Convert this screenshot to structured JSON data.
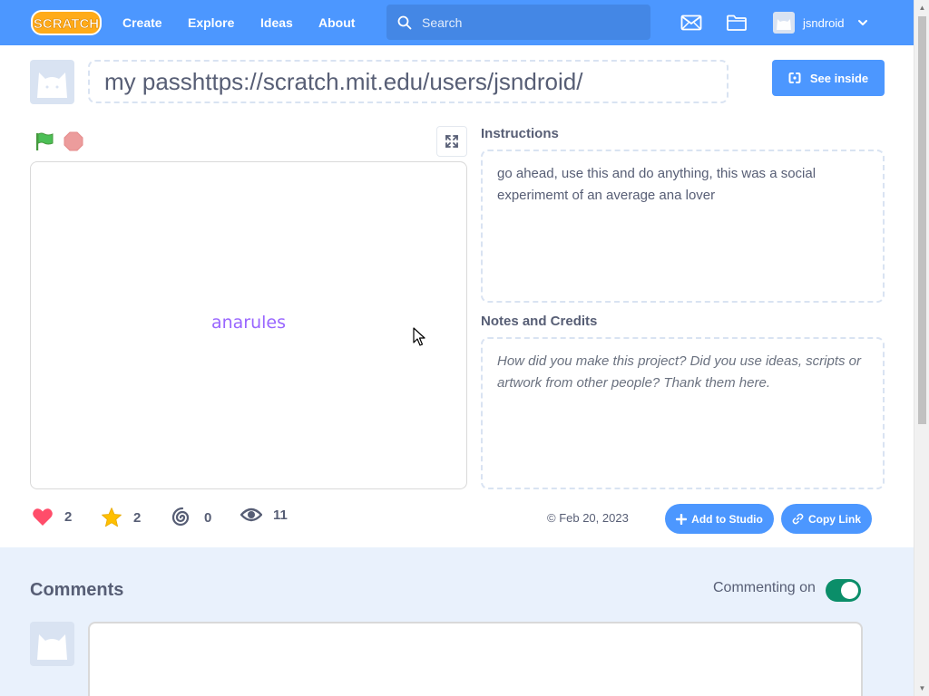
{
  "nav": {
    "logo_text": "SCRATCH",
    "links": [
      "Create",
      "Explore",
      "Ideas",
      "About"
    ],
    "search_placeholder": "Search",
    "username": "jsndroid"
  },
  "project": {
    "title": "my passhttps://scratch.mit.edu/users/jsndroid/",
    "see_inside_label": "See inside",
    "stage_text": "anarules"
  },
  "instructions": {
    "label": "Instructions",
    "text": "go ahead, use this and do anything, this was a social experimemt of an average ana lover"
  },
  "notes": {
    "label": "Notes and Credits",
    "placeholder": "How did you make this project? Did you use ideas, scripts or artwork from other people? Thank them here."
  },
  "stats": {
    "loves": "2",
    "favorites": "2",
    "remixes": "0",
    "views": "11"
  },
  "share_date": "© Feb 20, 2023",
  "actions": {
    "add_to_studio": "Add to Studio",
    "copy_link": "Copy Link"
  },
  "comments": {
    "title": "Comments",
    "commenting_label": "Commenting on",
    "commenting_on": true
  },
  "colors": {
    "brand": "#4c97ff",
    "text": "#575e75",
    "stage_text": "#9966ff",
    "toggle_on": "#0b8e69",
    "comments_bg": "#e9f1fc"
  }
}
